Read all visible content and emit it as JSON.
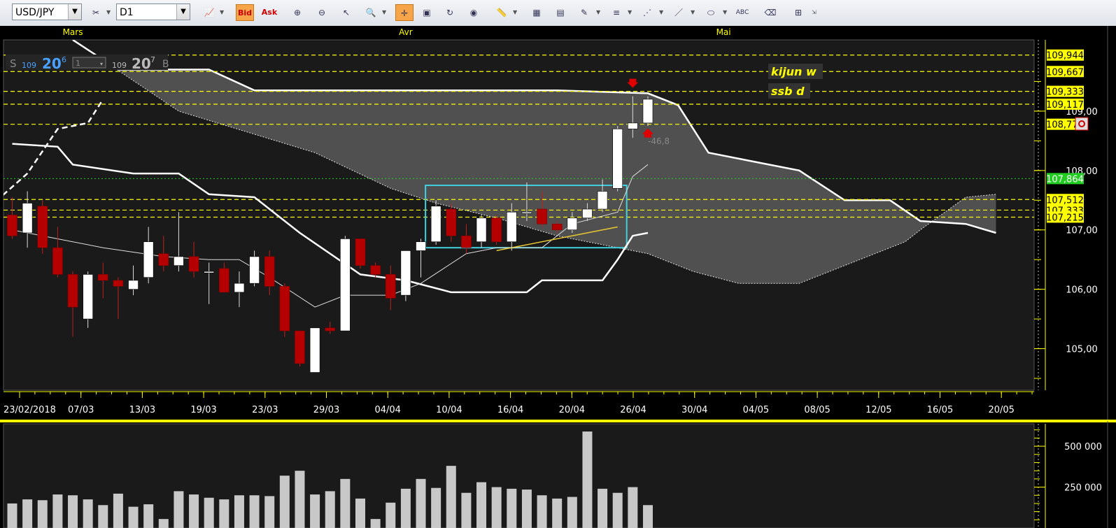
{
  "toolbar": {
    "symbol": "USD/JPY",
    "timeframe": "D1",
    "bid_label": "Bid",
    "ask_label": "Ask",
    "icons": [
      "crosshair-icon",
      "hand-icon",
      "zoom-icon",
      "line-icon",
      "fibonacci-icon",
      "channel-icon",
      "ellipse-icon",
      "text-icon",
      "eraser-icon",
      "tree-icon"
    ]
  },
  "quote": {
    "sell_label": "S",
    "sell_big": "109",
    "sell_pips": "20",
    "sell_frac": "6",
    "qty": "1",
    "buy_big": "109",
    "buy_pips": "20",
    "buy_frac": "7",
    "buy_label": "B"
  },
  "annotations": {
    "kijun": "kijun w",
    "ssb": "ssb d",
    "delta": "-46,8"
  },
  "colors": {
    "background": "#1a1a1a",
    "bull_candle": "#ffffff",
    "bear_candle": "#b40000",
    "cloud": "#5a5a5a",
    "highlight_box": "#40d0e0",
    "axis_accent": "#ffff00",
    "price_label_bg": "#ffff00",
    "current_price_bg": "#22cc22"
  },
  "chart_data": {
    "type": "candlestick",
    "symbol": "USD/JPY",
    "timeframe": "D1",
    "months": [
      {
        "label": "Mars",
        "date": "2018-03-01"
      },
      {
        "label": "Avr",
        "date": "2018-04-02"
      },
      {
        "label": "Mai",
        "date": "2018-05-01"
      }
    ],
    "x_tick_labels": [
      "23/02/2018",
      "07/03",
      "13/03",
      "19/03",
      "23/03",
      "29/03",
      "04/04",
      "10/04",
      "16/04",
      "20/04",
      "26/04",
      "30/04",
      "04/05",
      "08/05",
      "12/05",
      "16/05",
      "20/05"
    ],
    "y_tick_labels": [
      "105,00",
      "106,00",
      "107,00",
      "108,00",
      "109,00"
    ],
    "price_levels": [
      {
        "label": "109,944",
        "value": 109.944
      },
      {
        "label": "109,667",
        "value": 109.667
      },
      {
        "label": "109,333",
        "value": 109.333
      },
      {
        "label": "109,117",
        "value": 109.117
      },
      {
        "label": "108,779",
        "value": 108.779
      },
      {
        "label": "107,864",
        "value": 107.864,
        "current": true
      },
      {
        "label": "107,512",
        "value": 107.512
      },
      {
        "label": "107,333",
        "value": 107.333
      },
      {
        "label": "107,215",
        "value": 107.215
      }
    ],
    "ylim": [
      104.3,
      110.2
    ],
    "candles": [
      {
        "date": "2018-02-23",
        "o": 107.25,
        "h": 107.55,
        "l": 106.85,
        "c": 106.9
      },
      {
        "date": "2018-02-26",
        "o": 106.95,
        "h": 107.65,
        "l": 106.7,
        "c": 107.45
      },
      {
        "date": "2018-02-27",
        "o": 107.4,
        "h": 107.5,
        "l": 106.6,
        "c": 106.7
      },
      {
        "date": "2018-02-28",
        "o": 106.7,
        "h": 107.05,
        "l": 106.2,
        "c": 106.25
      },
      {
        "date": "2018-03-01",
        "o": 106.25,
        "h": 106.3,
        "l": 105.2,
        "c": 105.7
      },
      {
        "date": "2018-03-02",
        "o": 105.5,
        "h": 106.3,
        "l": 105.35,
        "c": 106.25
      },
      {
        "date": "2018-03-05",
        "o": 106.25,
        "h": 106.45,
        "l": 105.85,
        "c": 106.15
      },
      {
        "date": "2018-03-06",
        "o": 106.15,
        "h": 106.2,
        "l": 105.5,
        "c": 106.05
      },
      {
        "date": "2018-03-07",
        "o": 106.0,
        "h": 106.4,
        "l": 105.9,
        "c": 106.15
      },
      {
        "date": "2018-03-08",
        "o": 106.2,
        "h": 107.05,
        "l": 106.1,
        "c": 106.8
      },
      {
        "date": "2018-03-09",
        "o": 106.6,
        "h": 106.9,
        "l": 106.3,
        "c": 106.4
      },
      {
        "date": "2018-03-12",
        "o": 106.4,
        "h": 107.3,
        "l": 106.3,
        "c": 106.55
      },
      {
        "date": "2018-03-13",
        "o": 106.55,
        "h": 106.8,
        "l": 106.2,
        "c": 106.3
      },
      {
        "date": "2018-03-14",
        "o": 106.3,
        "h": 106.45,
        "l": 105.75,
        "c": 106.3
      },
      {
        "date": "2018-03-15",
        "o": 106.35,
        "h": 106.45,
        "l": 105.95,
        "c": 105.95
      },
      {
        "date": "2018-03-16",
        "o": 105.95,
        "h": 106.3,
        "l": 105.7,
        "c": 106.1
      },
      {
        "date": "2018-03-19",
        "o": 106.1,
        "h": 106.65,
        "l": 106.05,
        "c": 106.55
      },
      {
        "date": "2018-03-20",
        "o": 106.55,
        "h": 106.65,
        "l": 105.9,
        "c": 106.05
      },
      {
        "date": "2018-03-21",
        "o": 106.05,
        "h": 106.1,
        "l": 105.2,
        "c": 105.3
      },
      {
        "date": "2018-03-22",
        "o": 105.3,
        "h": 105.3,
        "l": 104.7,
        "c": 104.75
      },
      {
        "date": "2018-03-23",
        "o": 104.6,
        "h": 105.35,
        "l": 104.6,
        "c": 105.35
      },
      {
        "date": "2018-03-26",
        "o": 105.35,
        "h": 105.45,
        "l": 105.25,
        "c": 105.3
      },
      {
        "date": "2018-03-27",
        "o": 105.3,
        "h": 106.9,
        "l": 105.3,
        "c": 106.85
      },
      {
        "date": "2018-03-28",
        "o": 106.85,
        "h": 106.85,
        "l": 106.35,
        "c": 106.4
      },
      {
        "date": "2018-03-29",
        "o": 106.4,
        "h": 106.45,
        "l": 106.2,
        "c": 106.25
      },
      {
        "date": "2018-03-30",
        "o": 106.25,
        "h": 106.4,
        "l": 105.65,
        "c": 105.85
      },
      {
        "date": "2018-04-02",
        "o": 105.9,
        "h": 106.65,
        "l": 105.8,
        "c": 106.65
      },
      {
        "date": "2018-04-03",
        "o": 106.65,
        "h": 106.85,
        "l": 106.2,
        "c": 106.8
      },
      {
        "date": "2018-04-04",
        "o": 106.8,
        "h": 107.5,
        "l": 106.75,
        "c": 107.4
      },
      {
        "date": "2018-04-05",
        "o": 107.35,
        "h": 107.45,
        "l": 106.8,
        "c": 106.9
      },
      {
        "date": "2018-04-06",
        "o": 106.9,
        "h": 107.1,
        "l": 106.6,
        "c": 106.7
      },
      {
        "date": "2018-04-09",
        "o": 106.8,
        "h": 107.25,
        "l": 106.7,
        "c": 107.2
      },
      {
        "date": "2018-04-10",
        "o": 107.2,
        "h": 107.25,
        "l": 106.75,
        "c": 106.8
      },
      {
        "date": "2018-04-11",
        "o": 106.8,
        "h": 107.45,
        "l": 106.65,
        "c": 107.3
      },
      {
        "date": "2018-04-12",
        "o": 107.3,
        "h": 107.8,
        "l": 107.15,
        "c": 107.3
      },
      {
        "date": "2018-04-13",
        "o": 107.35,
        "h": 107.65,
        "l": 107.05,
        "c": 107.1
      },
      {
        "date": "2018-04-16",
        "o": 107.1,
        "h": 107.15,
        "l": 106.95,
        "c": 107.0
      },
      {
        "date": "2018-04-17",
        "o": 107.0,
        "h": 107.3,
        "l": 106.95,
        "c": 107.2
      },
      {
        "date": "2018-04-18",
        "o": 107.2,
        "h": 107.45,
        "l": 107.15,
        "c": 107.35
      },
      {
        "date": "2018-04-19",
        "o": 107.35,
        "h": 107.85,
        "l": 107.3,
        "c": 107.65
      },
      {
        "date": "2018-04-20",
        "o": 107.7,
        "h": 108.75,
        "l": 107.65,
        "c": 108.7
      },
      {
        "date": "2018-04-23",
        "o": 108.7,
        "h": 109.25,
        "l": 108.55,
        "c": 108.8
      },
      {
        "date": "2018-04-24",
        "o": 108.8,
        "h": 109.25,
        "l": 108.75,
        "c": 109.2
      }
    ],
    "tenkan": [
      {
        "date": "2018-02-23",
        "v": 107.0
      },
      {
        "date": "2018-03-01",
        "v": 106.8
      },
      {
        "date": "2018-03-05",
        "v": 106.7
      },
      {
        "date": "2018-03-09",
        "v": 106.55
      },
      {
        "date": "2018-03-14",
        "v": 106.5
      },
      {
        "date": "2018-03-16",
        "v": 106.5
      },
      {
        "date": "2018-03-20",
        "v": 106.2
      },
      {
        "date": "2018-03-23",
        "v": 105.7
      },
      {
        "date": "2018-03-27",
        "v": 105.9
      },
      {
        "date": "2018-03-30",
        "v": 105.9
      },
      {
        "date": "2018-04-03",
        "v": 106.1
      },
      {
        "date": "2018-04-06",
        "v": 106.6
      },
      {
        "date": "2018-04-10",
        "v": 106.7
      },
      {
        "date": "2018-04-13",
        "v": 106.7
      },
      {
        "date": "2018-04-17",
        "v": 107.1
      },
      {
        "date": "2018-04-20",
        "v": 107.3
      },
      {
        "date": "2018-04-23",
        "v": 107.9
      },
      {
        "date": "2018-04-24",
        "v": 108.1
      }
    ],
    "kijun": [
      {
        "date": "2018-02-23",
        "v": 108.45
      },
      {
        "date": "2018-02-28",
        "v": 108.4
      },
      {
        "date": "2018-03-01",
        "v": 108.1
      },
      {
        "date": "2018-03-07",
        "v": 107.95
      },
      {
        "date": "2018-03-12",
        "v": 107.95
      },
      {
        "date": "2018-03-14",
        "v": 107.6
      },
      {
        "date": "2018-03-19",
        "v": 107.55
      },
      {
        "date": "2018-03-22",
        "v": 106.95
      },
      {
        "date": "2018-03-28",
        "v": 106.25
      },
      {
        "date": "2018-04-02",
        "v": 106.15
      },
      {
        "date": "2018-04-05",
        "v": 105.95
      },
      {
        "date": "2018-04-12",
        "v": 105.95
      },
      {
        "date": "2018-04-13",
        "v": 106.15
      },
      {
        "date": "2018-04-19",
        "v": 106.15
      },
      {
        "date": "2018-04-20",
        "v": 106.5
      },
      {
        "date": "2018-04-23",
        "v": 106.9
      },
      {
        "date": "2018-04-24",
        "v": 106.95
      }
    ],
    "chikou": [
      {
        "date": "2018-01-24",
        "v": 106.0
      },
      {
        "date": "2018-01-26",
        "v": 106.75
      },
      {
        "date": "2018-01-30",
        "v": 107.0
      },
      {
        "date": "2018-02-02",
        "v": 107.25
      },
      {
        "date": "2018-02-06",
        "v": 106.9
      },
      {
        "date": "2018-02-08",
        "v": 107.35
      },
      {
        "date": "2018-02-13",
        "v": 106.95
      },
      {
        "date": "2018-02-15",
        "v": 107.4
      },
      {
        "date": "2018-02-19",
        "v": 107.25
      },
      {
        "date": "2018-02-22",
        "v": 107.5
      },
      {
        "date": "2018-02-26",
        "v": 107.95
      },
      {
        "date": "2018-02-28",
        "v": 108.7
      },
      {
        "date": "2018-03-02",
        "v": 108.8
      },
      {
        "date": "2018-03-05",
        "v": 109.2
      }
    ],
    "senkou_a": [
      {
        "date": "2018-03-01",
        "v": 110.2
      },
      {
        "date": "2018-03-06",
        "v": 109.7
      },
      {
        "date": "2018-03-14",
        "v": 109.7
      },
      {
        "date": "2018-03-19",
        "v": 109.35
      },
      {
        "date": "2018-03-27",
        "v": 109.35
      },
      {
        "date": "2018-04-03",
        "v": 109.35
      },
      {
        "date": "2018-04-16",
        "v": 109.35
      },
      {
        "date": "2018-04-24",
        "v": 109.3
      },
      {
        "date": "2018-04-26",
        "v": 109.1
      },
      {
        "date": "2018-04-30",
        "v": 108.3
      },
      {
        "date": "2018-05-03",
        "v": 108.15
      },
      {
        "date": "2018-05-08",
        "v": 108.0
      },
      {
        "date": "2018-05-12",
        "v": 107.5
      },
      {
        "date": "2018-05-16",
        "v": 107.5
      },
      {
        "date": "2018-05-20",
        "v": 107.15
      },
      {
        "date": "2018-05-23",
        "v": 107.1
      },
      {
        "date": "2018-05-25",
        "v": 106.95
      }
    ],
    "senkou_b": [
      {
        "date": "2018-03-01",
        "v": 110.2
      },
      {
        "date": "2018-03-12",
        "v": 109.0
      },
      {
        "date": "2018-03-23",
        "v": 108.3
      },
      {
        "date": "2018-03-30",
        "v": 107.7
      },
      {
        "date": "2018-04-04",
        "v": 107.45
      },
      {
        "date": "2018-04-10",
        "v": 107.2
      },
      {
        "date": "2018-04-16",
        "v": 106.9
      },
      {
        "date": "2018-04-24",
        "v": 106.6
      },
      {
        "date": "2018-04-28",
        "v": 106.3
      },
      {
        "date": "2018-05-02",
        "v": 106.1
      },
      {
        "date": "2018-05-08",
        "v": 106.1
      },
      {
        "date": "2018-05-12",
        "v": 106.4
      },
      {
        "date": "2018-05-17",
        "v": 106.8
      },
      {
        "date": "2018-05-20",
        "v": 107.0
      },
      {
        "date": "2018-05-23",
        "v": 107.55
      },
      {
        "date": "2018-05-25",
        "v": 107.6
      }
    ],
    "trend_line": [
      {
        "date": "2018-04-10",
        "v": 106.65
      },
      {
        "date": "2018-04-20",
        "v": 107.05
      }
    ],
    "highlight_box": {
      "date_start": "2018-04-04",
      "date_end": "2018-04-20",
      "y_low": 106.7,
      "y_high": 107.75
    },
    "signals": [
      {
        "date": "2018-04-23",
        "type": "down",
        "v": 109.45
      },
      {
        "date": "2018-04-24",
        "type": "up",
        "v": 108.65
      }
    ],
    "volume": {
      "y_tick_labels": [
        "250 000",
        "500 000"
      ],
      "ylim": [
        0,
        620000
      ],
      "values": [
        150000,
        175000,
        170000,
        205000,
        200000,
        175000,
        140000,
        210000,
        130000,
        145000,
        55000,
        225000,
        205000,
        185000,
        175000,
        200000,
        200000,
        195000,
        320000,
        350000,
        205000,
        225000,
        300000,
        180000,
        55000,
        155000,
        240000,
        300000,
        245000,
        380000,
        215000,
        280000,
        250000,
        240000,
        235000,
        200000,
        180000,
        190000,
        590000,
        240000,
        215000,
        250000,
        140000
      ]
    }
  }
}
